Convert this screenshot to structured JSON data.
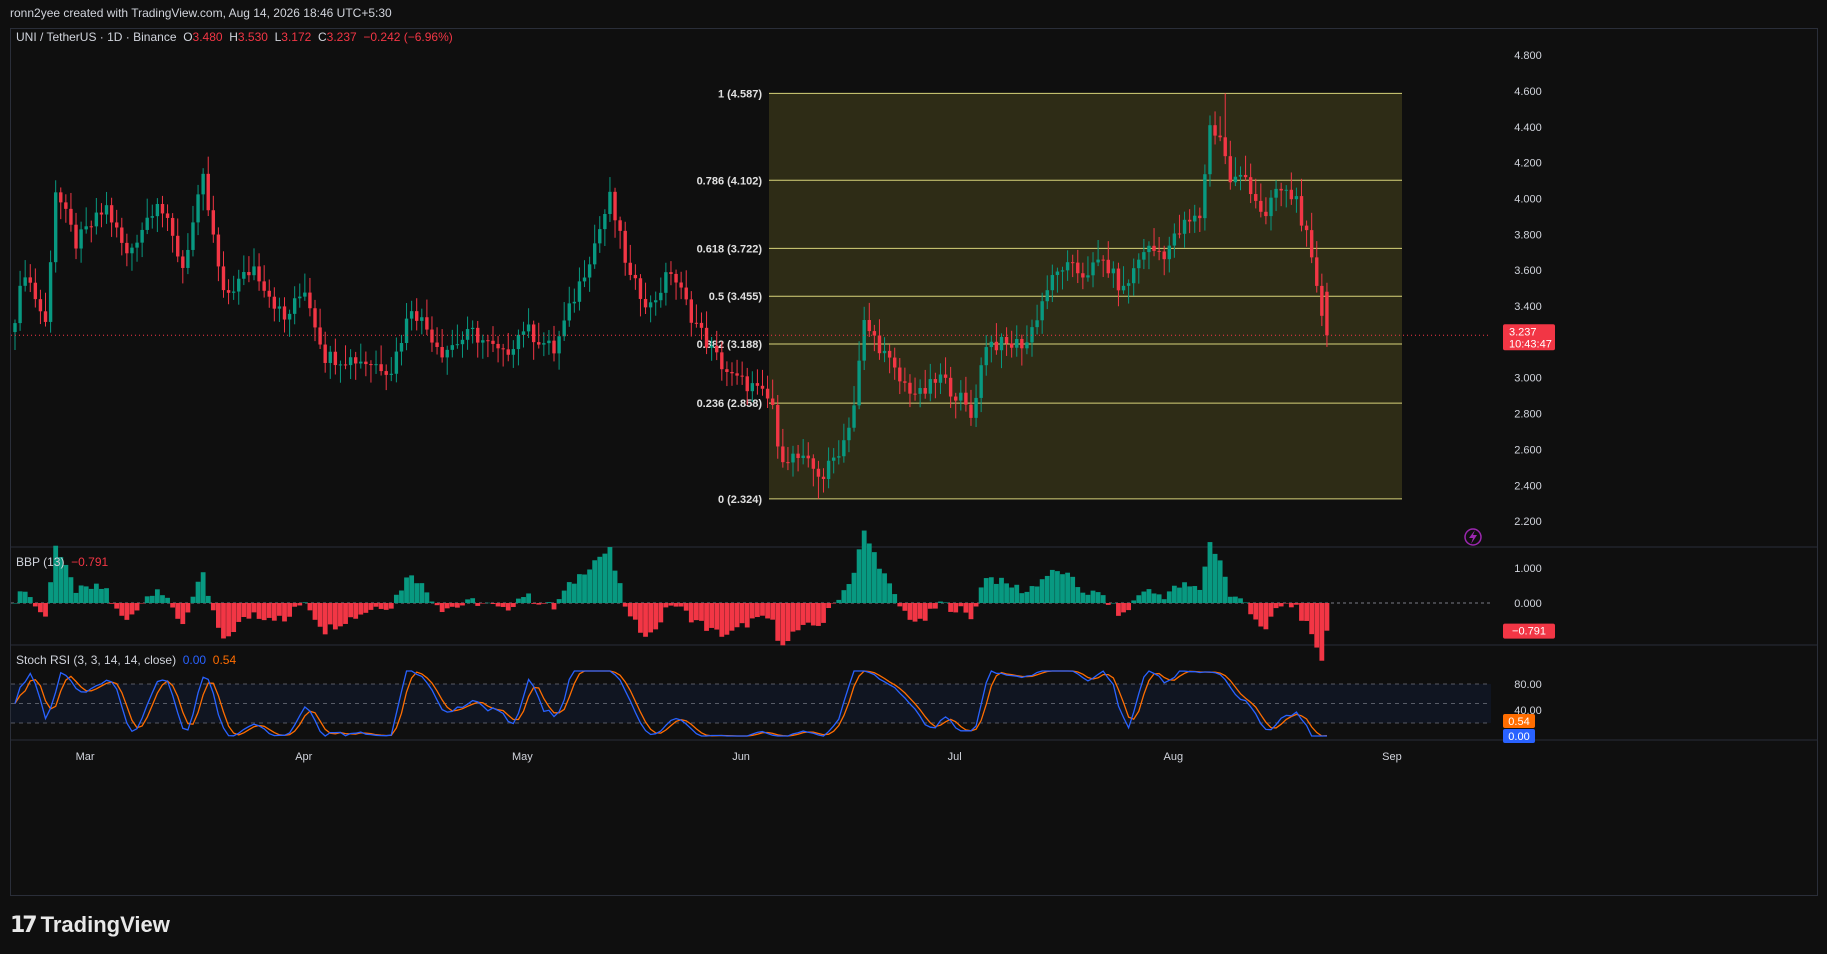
{
  "header": {
    "attribution": "ronn2yee created with TradingView.com, Aug 14, 2026 18:46 UTC+5:30"
  },
  "legend": {
    "symbol": "UNI / TetherUS · 1D · Binance",
    "o_key": "O",
    "o_val": "3.480",
    "h_key": "H",
    "h_val": "3.530",
    "l_key": "L",
    "l_val": "3.172",
    "c_key": "C",
    "c_val": "3.237",
    "change": "−0.242 (−6.96%)"
  },
  "bbp_legend": {
    "name": "BBP (13)",
    "value": "−0.791"
  },
  "stoch_legend": {
    "name": "Stoch RSI (3, 3, 14, 14, close)",
    "k": "0.00",
    "d": "0.54"
  },
  "price_tag": {
    "price": "3.237",
    "countdown": "10:43:47"
  },
  "bbp_tag": "−0.791",
  "stoch_tags": {
    "d": "0.54",
    "k": "0.00"
  },
  "colors": {
    "up": "#089981",
    "down": "#f23645",
    "fib": "#d8d37a",
    "k": "#2962ff",
    "d": "#ff6d00"
  },
  "brand": {
    "name": "TradingView"
  },
  "chart_data": {
    "type": "candlestick",
    "price_axis": {
      "ticks": [
        "2.200",
        "2.400",
        "2.600",
        "2.800",
        "3.000",
        "3.200",
        "3.400",
        "3.600",
        "3.800",
        "4.000",
        "4.200",
        "4.400",
        "4.600",
        "4.800"
      ]
    },
    "time_axis": {
      "labels": [
        "Mar",
        "Apr",
        "May",
        "Jun",
        "Jul",
        "Aug",
        "Sep"
      ]
    },
    "fibonacci": [
      {
        "label": "1 (4.587)",
        "price": 4.587
      },
      {
        "label": "0.786 (4.102)",
        "price": 4.102
      },
      {
        "label": "0.618 (3.722)",
        "price": 3.722
      },
      {
        "label": "0.5 (3.455)",
        "price": 3.455
      },
      {
        "label": "0.382 (3.188)",
        "price": 3.188
      },
      {
        "label": "0.236 (2.858)",
        "price": 2.858
      },
      {
        "label": "0 (2.324)",
        "price": 2.324
      }
    ],
    "anchors": [
      [
        0,
        3.35
      ],
      [
        2,
        3.6
      ],
      [
        6,
        3.3
      ],
      [
        8,
        4.05
      ],
      [
        12,
        3.75
      ],
      [
        18,
        3.95
      ],
      [
        22,
        3.68
      ],
      [
        28,
        4.0
      ],
      [
        33,
        3.62
      ],
      [
        37,
        4.1
      ],
      [
        41,
        3.45
      ],
      [
        47,
        3.62
      ],
      [
        53,
        3.32
      ],
      [
        57,
        3.5
      ],
      [
        61,
        3.12
      ],
      [
        68,
        3.1
      ],
      [
        74,
        3.05
      ],
      [
        78,
        3.4
      ],
      [
        84,
        3.15
      ],
      [
        90,
        3.25
      ],
      [
        96,
        3.12
      ],
      [
        100,
        3.28
      ],
      [
        106,
        3.15
      ],
      [
        110,
        3.45
      ],
      [
        114,
        3.75
      ],
      [
        117,
        4.0
      ],
      [
        121,
        3.55
      ],
      [
        125,
        3.4
      ],
      [
        129,
        3.6
      ],
      [
        133,
        3.35
      ],
      [
        137,
        3.15
      ],
      [
        141,
        3.0
      ],
      [
        145,
        2.95
      ],
      [
        149,
        2.85
      ],
      [
        150,
        2.58
      ],
      [
        154,
        2.55
      ],
      [
        159,
        2.45
      ],
      [
        163,
        2.65
      ],
      [
        165,
        2.85
      ],
      [
        167,
        3.3
      ],
      [
        170,
        3.18
      ],
      [
        174,
        2.98
      ],
      [
        178,
        2.9
      ],
      [
        182,
        3.0
      ],
      [
        186,
        2.88
      ],
      [
        188,
        2.78
      ],
      [
        191,
        3.2
      ],
      [
        195,
        3.18
      ],
      [
        199,
        3.2
      ],
      [
        203,
        3.5
      ],
      [
        206,
        3.62
      ],
      [
        210,
        3.58
      ],
      [
        214,
        3.65
      ],
      [
        218,
        3.48
      ],
      [
        222,
        3.72
      ],
      [
        226,
        3.7
      ],
      [
        230,
        3.85
      ],
      [
        233,
        3.9
      ],
      [
        235,
        4.4
      ],
      [
        237,
        4.35
      ],
      [
        239,
        4.1
      ],
      [
        242,
        4.12
      ],
      [
        246,
        3.88
      ],
      [
        248,
        4.05
      ],
      [
        252,
        4.0
      ],
      [
        254,
        3.78
      ],
      [
        256,
        3.48
      ],
      [
        258,
        3.237
      ]
    ],
    "bbp_range": [
      -1.0,
      1.0
    ],
    "bbp_ticks": [
      "1.000",
      "0.000"
    ],
    "stoch_ticks": [
      "80.00",
      "40.00"
    ],
    "stoch_bands": [
      80,
      20
    ]
  }
}
